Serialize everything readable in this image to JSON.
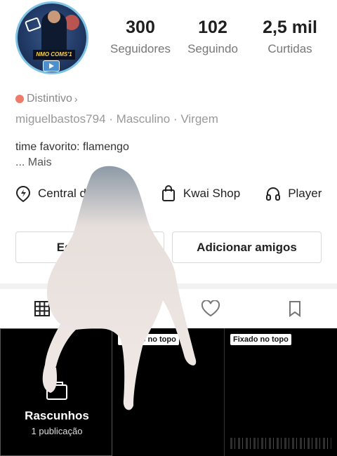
{
  "profile": {
    "avatar_caption": "NMO COMS'1",
    "stats": [
      {
        "value": "300",
        "label": "Seguidores"
      },
      {
        "value": "102",
        "label": "Seguindo"
      },
      {
        "value": "2,5 mil",
        "label": "Curtidas"
      }
    ],
    "badge_label": "Distintivo",
    "username": "miguelbastos794",
    "gender": "Masculino",
    "sign": "Virgem",
    "meta_separator": "·",
    "bio_line": "time favorito: flamengo",
    "bio_more": "...  Mais"
  },
  "links": [
    {
      "label": "Central do Criador",
      "icon": "lightning-pin-icon"
    },
    {
      "label": "Kwai Shop",
      "icon": "shopping-bag-icon"
    },
    {
      "label": "Player",
      "icon": "headphones-icon"
    }
  ],
  "actions": {
    "edit_label": "Editar perfil",
    "add_friends_label": "Adicionar amigos"
  },
  "tabs": [
    {
      "name": "posts",
      "icon": "grid-icon"
    },
    {
      "name": "private",
      "icon": "lock-icon"
    },
    {
      "name": "likes",
      "icon": "heart-icon"
    },
    {
      "name": "saved",
      "icon": "bookmark-icon"
    }
  ],
  "grid": {
    "drafts_title": "Rascunhos",
    "drafts_count": "1 publicação",
    "pinned_label": "Fixado no topo"
  },
  "colors": {
    "badge_accent": "#f07a6a",
    "avatar_ring": "#7fc3e6",
    "sticker": "#ece6e3"
  }
}
